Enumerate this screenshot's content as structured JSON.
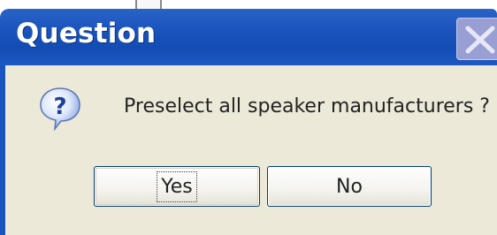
{
  "dialog": {
    "title": "Question",
    "message": "Preselect all speaker manufacturers ?",
    "buttons": {
      "yes": "Yes",
      "no": "No"
    }
  },
  "icons": {
    "message_icon": "question-icon",
    "close": "close-icon"
  },
  "colors": {
    "titlebar": "#1b54bd",
    "body": "#ece9d8",
    "title_text": "#ffffff",
    "close_button": "#9a9fd3",
    "button_border": "#003c74"
  }
}
